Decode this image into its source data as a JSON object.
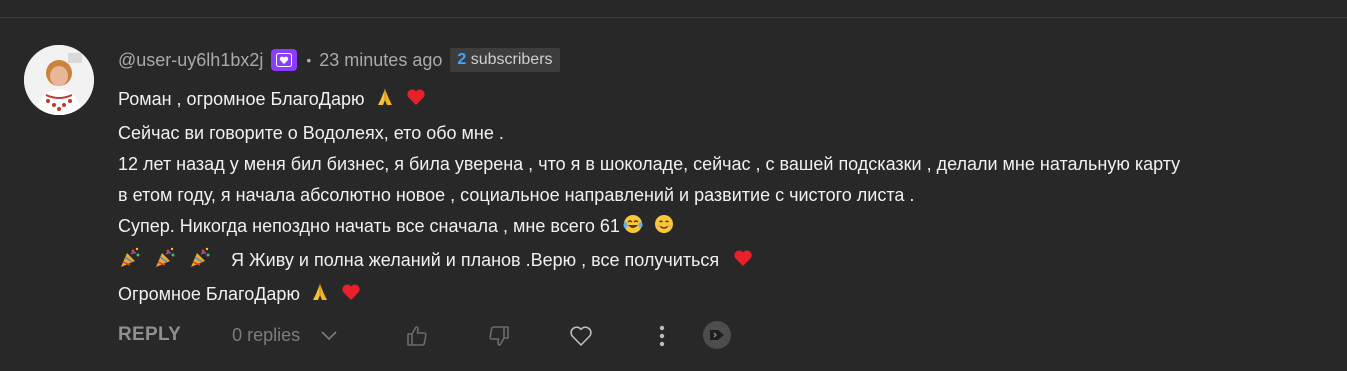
{
  "comment": {
    "username": "@user-uy6lh1bx2j",
    "separator": "•",
    "timestamp": "23 minutes ago",
    "subscriber_badge": {
      "count": "2",
      "label": "subscribers"
    },
    "lines": [
      "Роман , огромное БлагоДарю",
      "Сейчас ви говорите о Водолеях, ето обо мне .",
      "12 лет назад у меня бил бизнес, я била уверена , что я в шоколаде, сейчас , с вашей подсказки , делали мне натальную карту",
      "в етом году, я начала абсолютно новое , социальное направлений и развитие с чистого листа .",
      "Супер. Никогда непоздно начать все сначала , мне всего 61",
      "Я  Живу и полна  желаний и планов .Верю , все получиться",
      "Огромное БлагоДарю"
    ]
  },
  "actions": {
    "reply_label": "REPLY",
    "replies_label": "0 replies"
  },
  "colors": {
    "background": "#282828",
    "member_badge": "#8b3dff",
    "subscriber_count": "#3ea6ff",
    "heart": "#e8202a"
  },
  "icons": [
    "heart-emoji-icon",
    "folded-hands-emoji-icon",
    "tears-of-joy-emoji-icon",
    "smiling-face-emoji-icon",
    "party-popper-emoji-icon",
    "like-icon",
    "dislike-icon",
    "heart-icon",
    "more-vert-icon",
    "flag-icon",
    "chevron-down-icon",
    "member-badge-icon"
  ]
}
